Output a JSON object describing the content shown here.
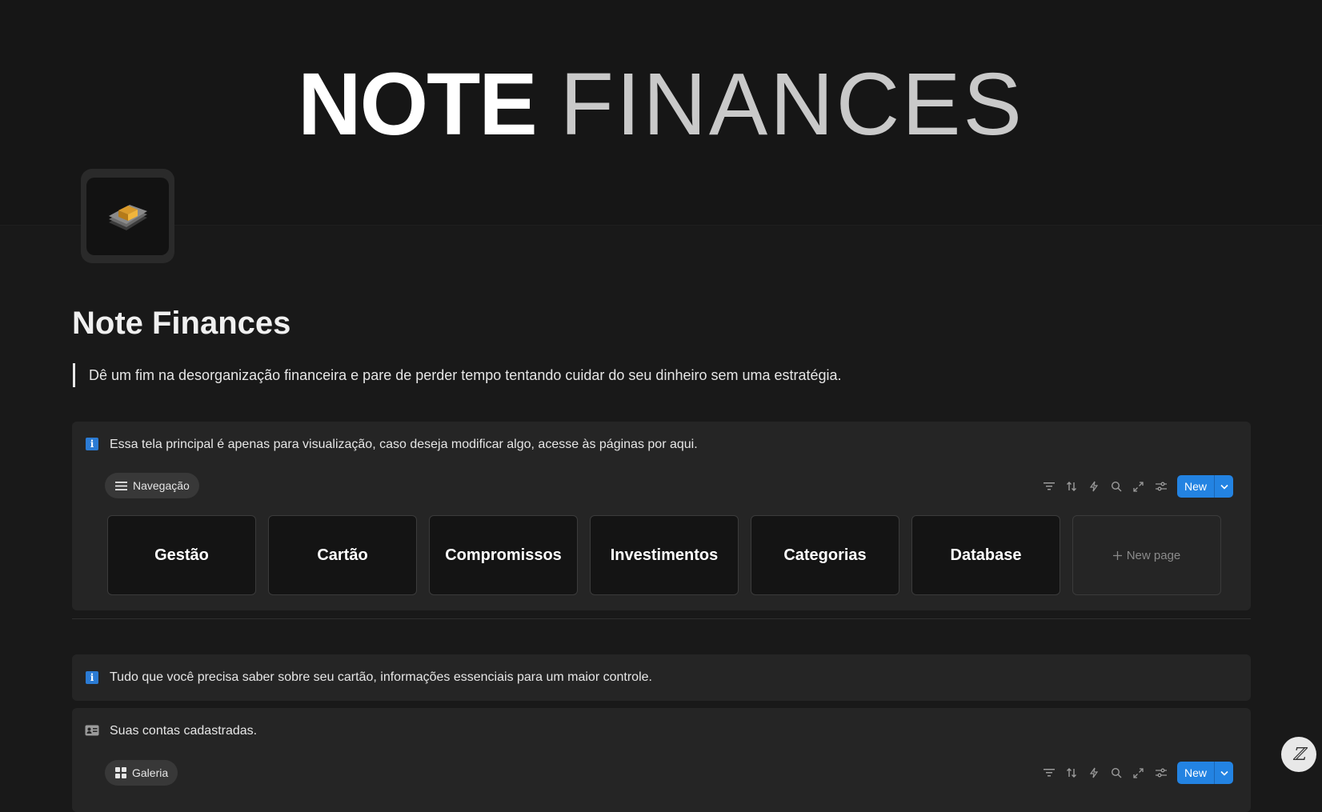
{
  "cover": {
    "title_bold": "NOTE",
    "title_light": "FINANCES"
  },
  "page": {
    "icon": "money-emoji-icon",
    "title": "Note Finances",
    "quote": "Dê um fim na desorganização financeira e pare de perder tempo tentando cuidar do seu dinheiro sem uma estratégia."
  },
  "nav_callout": {
    "text": "Essa tela principal é apenas para visualização, caso deseja modificar algo, acesse às páginas por aqui.",
    "view_tab": "Navegação",
    "new_label": "New",
    "cards": [
      "Gestão",
      "Cartão",
      "Compromissos",
      "Investimentos",
      "Categorias",
      "Database"
    ],
    "new_page_label": "New page"
  },
  "card_callout": {
    "text": "Tudo que você precisa saber sobre seu cartão, informações essenciais para um maior controle."
  },
  "accounts_callout": {
    "text": "Suas contas cadastradas.",
    "view_tab": "Galeria",
    "new_label": "New"
  },
  "colors": {
    "background": "#191919",
    "callout": "#252525",
    "accent": "#2383e2"
  }
}
